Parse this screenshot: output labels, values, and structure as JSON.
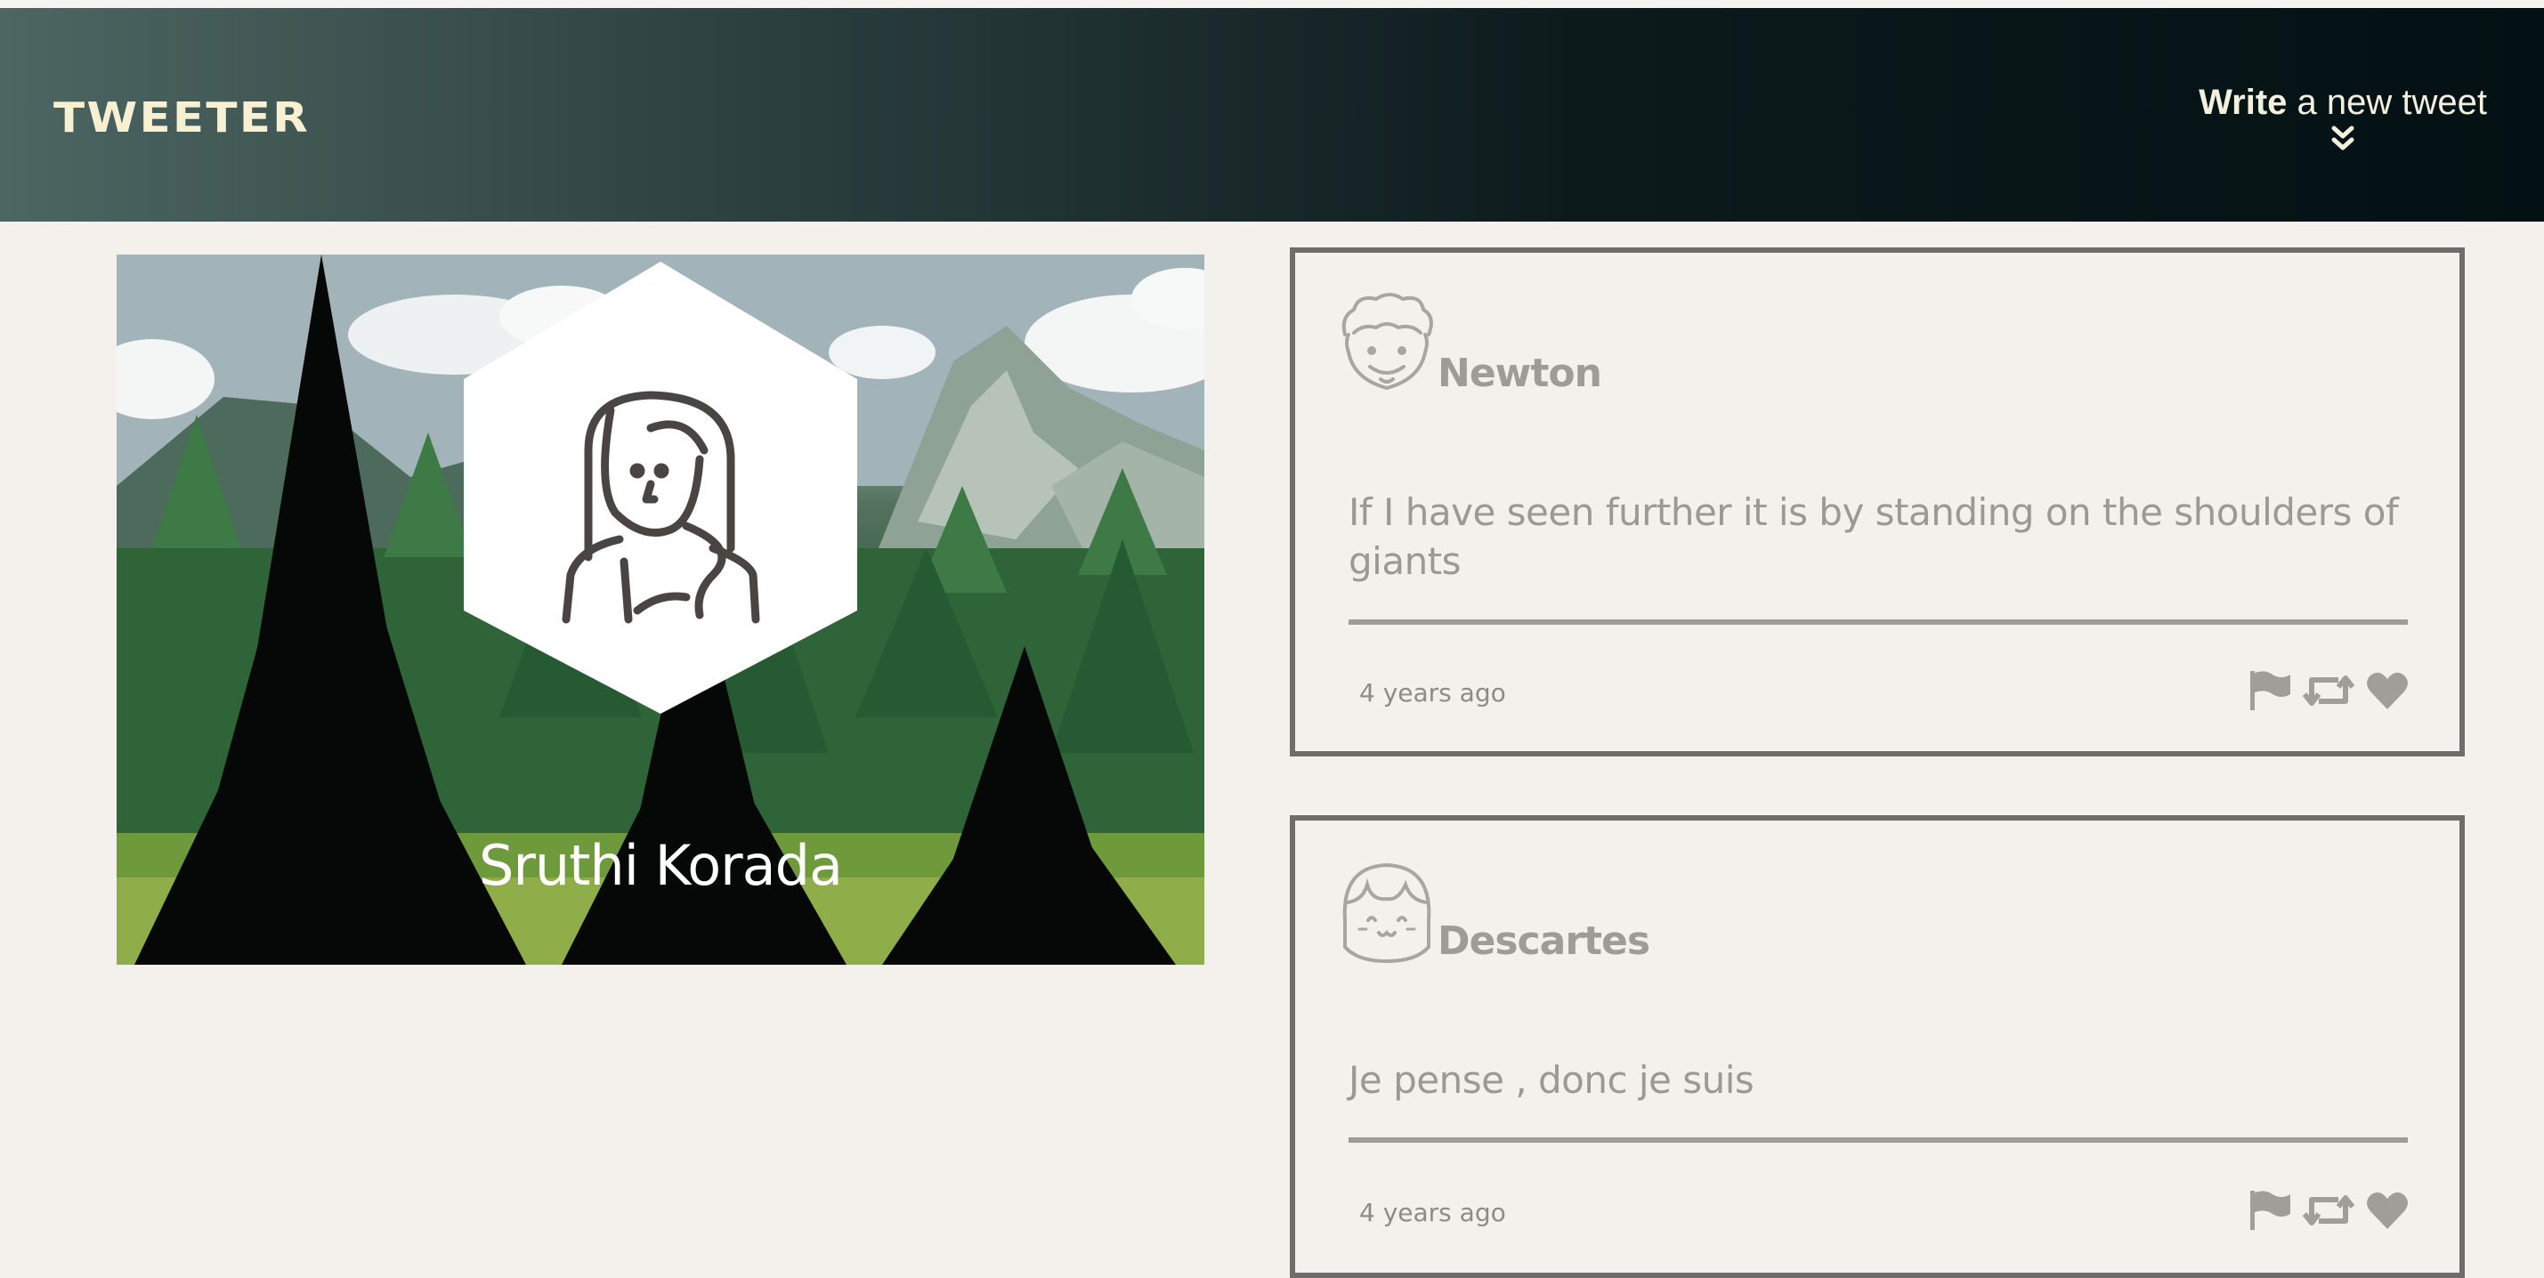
{
  "header": {
    "logo": "TWEETER",
    "compose_bold": "Write",
    "compose_rest": " a new tweet",
    "compose_icon": "double-chevron-down-icon"
  },
  "profile": {
    "name": "Sruthi Korada",
    "avatar_icon": "user-avatar-icon"
  },
  "tweets": [
    {
      "author": "Newton",
      "avatar_icon": "curly-hair-avatar-icon",
      "content": "If I have seen further it is by standing on the shoulders of giants",
      "time": "4 years ago",
      "actions": [
        "flag-icon",
        "retweet-icon",
        "heart-icon"
      ]
    },
    {
      "author": "Descartes",
      "avatar_icon": "bangs-avatar-icon",
      "content": "Je pense , donc je suis",
      "time": "4 years ago",
      "actions": [
        "flag-icon",
        "retweet-icon",
        "heart-icon"
      ]
    }
  ],
  "colors": {
    "page_bg": "#f4f1ed",
    "header_gradient_start": "#4d6662",
    "header_gradient_end": "#031114",
    "logo_color": "#f7f0d2",
    "card_border": "#6f6c69",
    "muted_text": "#9f9b97"
  }
}
